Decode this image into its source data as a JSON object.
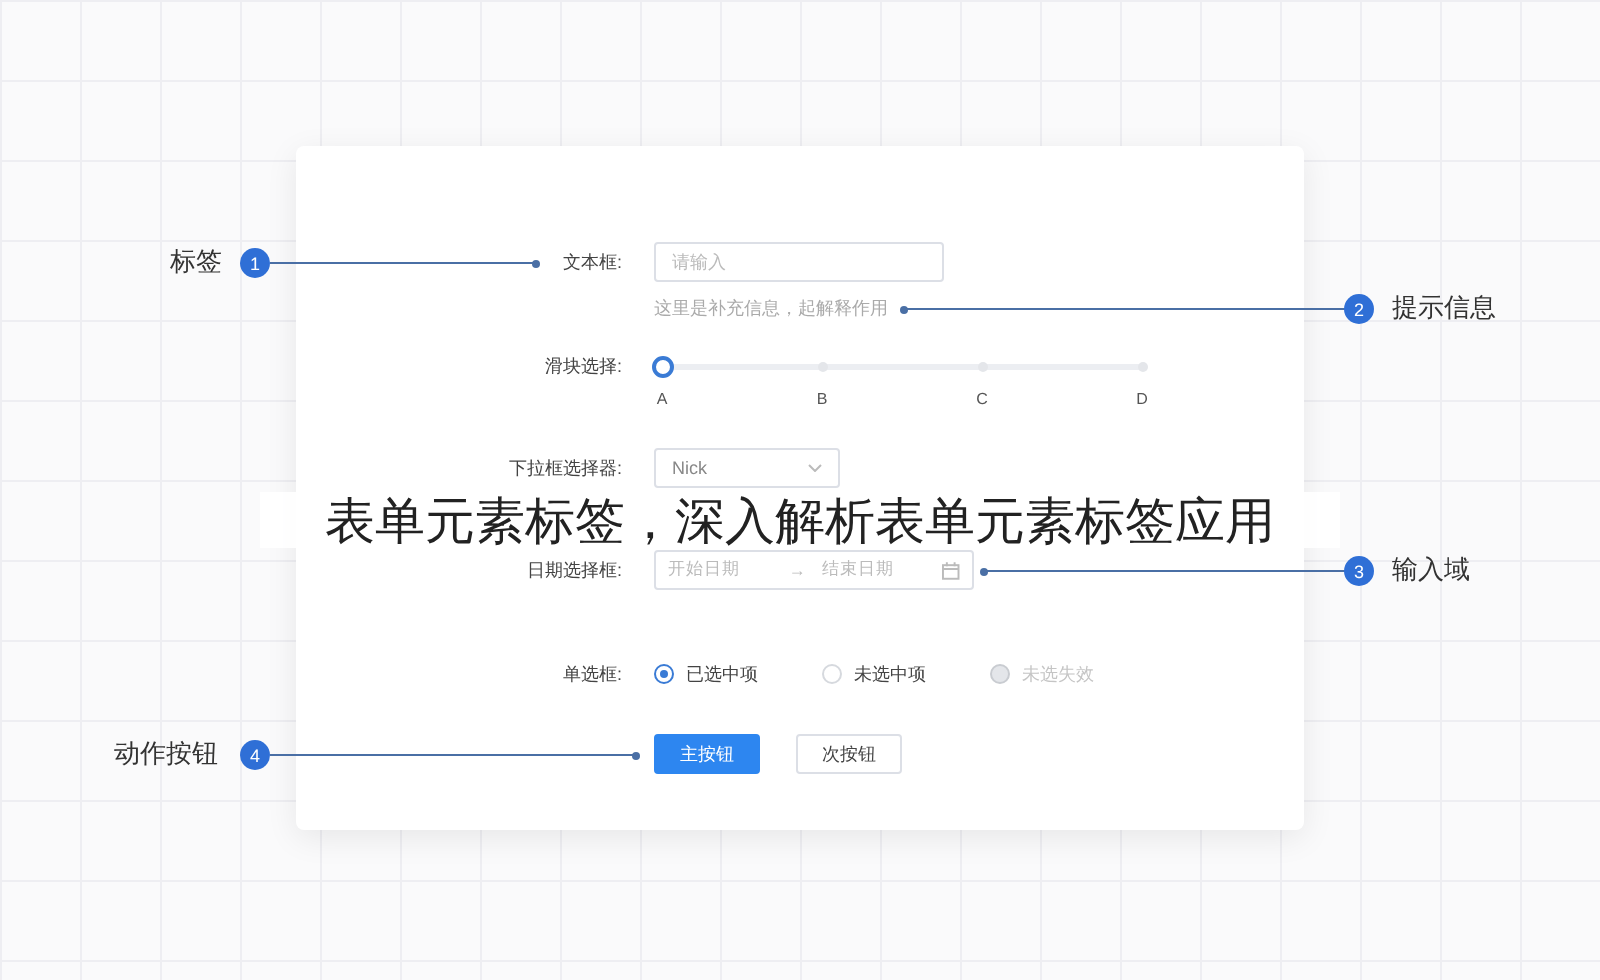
{
  "title": "表单元素标签，深入解析表单元素标签应用",
  "form": {
    "text_field": {
      "label": "文本框:",
      "placeholder": "请输入",
      "hint": "这里是补充信息，起解释作用"
    },
    "slider": {
      "label": "滑块选择:",
      "level": 0,
      "marks": [
        "A",
        "B",
        "C",
        "D"
      ]
    },
    "dropdown": {
      "label": "下拉框选择器:",
      "value": "Nick"
    },
    "date_range": {
      "label": "日期选择框:",
      "start_placeholder": "开始日期",
      "separator": "→",
      "end_placeholder": "结束日期"
    },
    "radio": {
      "label": "单选框:",
      "options": [
        {
          "label": "已选中项",
          "selected": true,
          "disabled": false
        },
        {
          "label": "未选中项",
          "selected": false,
          "disabled": false
        },
        {
          "label": "未选失效",
          "selected": false,
          "disabled": true
        }
      ]
    },
    "buttons": [
      {
        "label": "主按钮",
        "kind": "primary"
      },
      {
        "label": "次按钮",
        "kind": "secondary"
      }
    ]
  },
  "annotations": [
    {
      "number": "1",
      "label": "标签"
    },
    {
      "number": "2",
      "label": "提示信息"
    },
    {
      "number": "3",
      "label": "输入域"
    },
    {
      "number": "4",
      "label": "动作按钮"
    }
  ]
}
